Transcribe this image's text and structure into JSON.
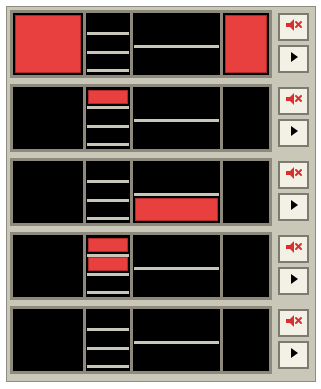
{
  "tracks": [
    {
      "lit": [
        "col1",
        "col4"
      ]
    },
    {
      "lit": [
        "col2-top"
      ]
    },
    {
      "lit": [
        "col3-bottom"
      ]
    },
    {
      "lit": [
        "col2-top",
        "col2-mid"
      ]
    },
    {
      "lit": []
    }
  ],
  "buttons": {
    "mute_icon": "speaker-mute-icon",
    "play_icon": "play-icon"
  },
  "colors": {
    "panel": "#c9c7b8",
    "grid_border": "#8d8a7d",
    "cell_bg": "#000000",
    "lit": "#e8403e",
    "button_bg": "#f3f1e6",
    "mute_red": "#d92f2f"
  }
}
